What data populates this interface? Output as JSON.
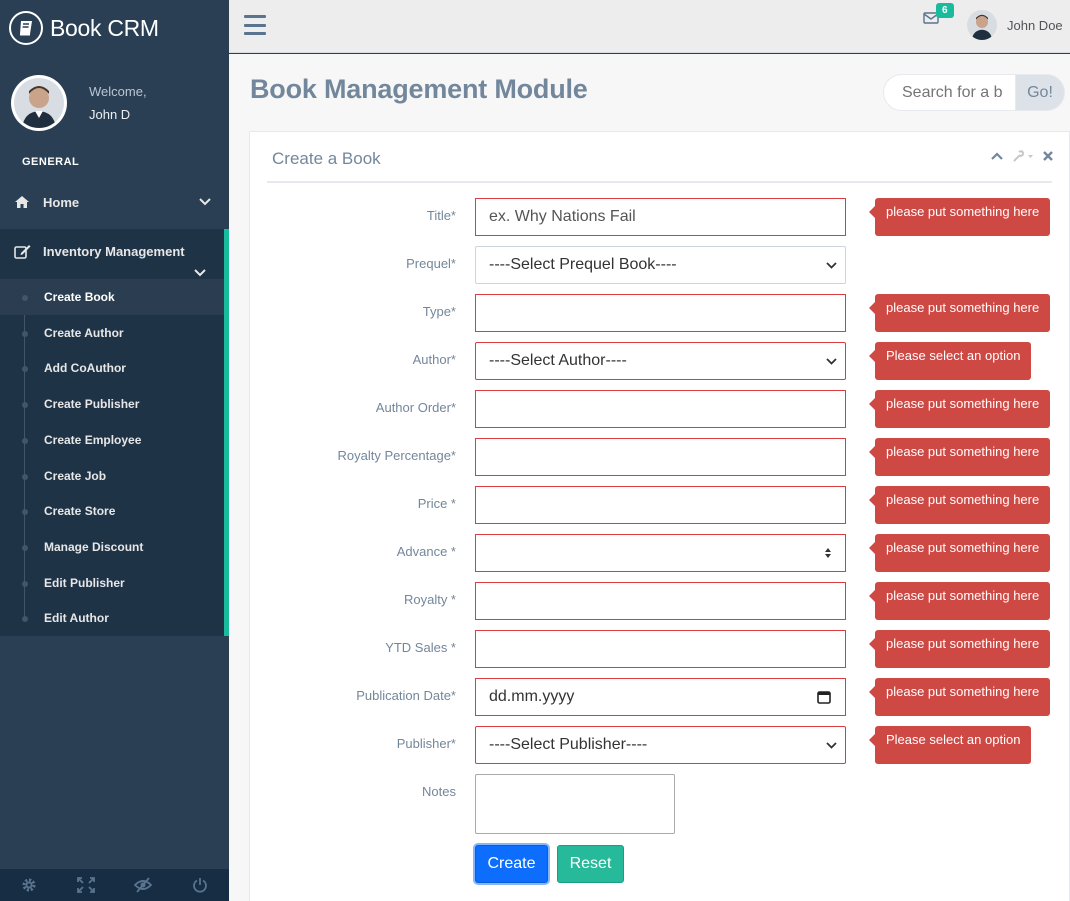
{
  "brand": {
    "name": "Book CRM"
  },
  "profile": {
    "welcome": "Welcome,",
    "name": "John D"
  },
  "sidebar": {
    "section_title": "GENERAL",
    "home": "Home",
    "inventory": "Inventory Management",
    "items": [
      {
        "label": "Create Book",
        "active": true
      },
      {
        "label": "Create Author"
      },
      {
        "label": "Add CoAuthor"
      },
      {
        "label": "Create Publisher"
      },
      {
        "label": "Create Employee"
      },
      {
        "label": "Create Job"
      },
      {
        "label": "Create Store"
      },
      {
        "label": "Manage Discount"
      },
      {
        "label": "Edit Publisher"
      },
      {
        "label": "Edit Author"
      }
    ]
  },
  "topbar": {
    "mail_count": "6",
    "user_name": "John Doe"
  },
  "page": {
    "title": "Book Management Module"
  },
  "search": {
    "placeholder": "Search for a b",
    "button": "Go!"
  },
  "panel": {
    "title": "Create a Book"
  },
  "form": {
    "title_label": "Title*",
    "title_placeholder": "ex. Why Nations Fail",
    "prequel_label": "Prequel*",
    "prequel_value": "----Select Prequel Book----",
    "type_label": "Type*",
    "author_label": "Author*",
    "author_value": "----Select Author----",
    "author_order_label": "Author Order*",
    "royalty_pct_label": "Royalty Percentage*",
    "price_label": "Price *",
    "advance_label": "Advance *",
    "royalty_label": "Royalty *",
    "ytd_label": "YTD Sales *",
    "pubdate_label": "Publication Date*",
    "pubdate_placeholder": "dd.mm.yyyy",
    "publisher_label": "Publisher*",
    "publisher_value": "----Select Publisher----",
    "notes_label": "Notes",
    "create_button": "Create",
    "reset_button": "Reset"
  },
  "validation": {
    "required_msg": "please put something here",
    "select_msg": "Please select an option"
  },
  "colors": {
    "sidebar": "#2a3f54",
    "accent": "#1abb9c",
    "error": "#ce4844",
    "primary": "#0d6efd"
  }
}
